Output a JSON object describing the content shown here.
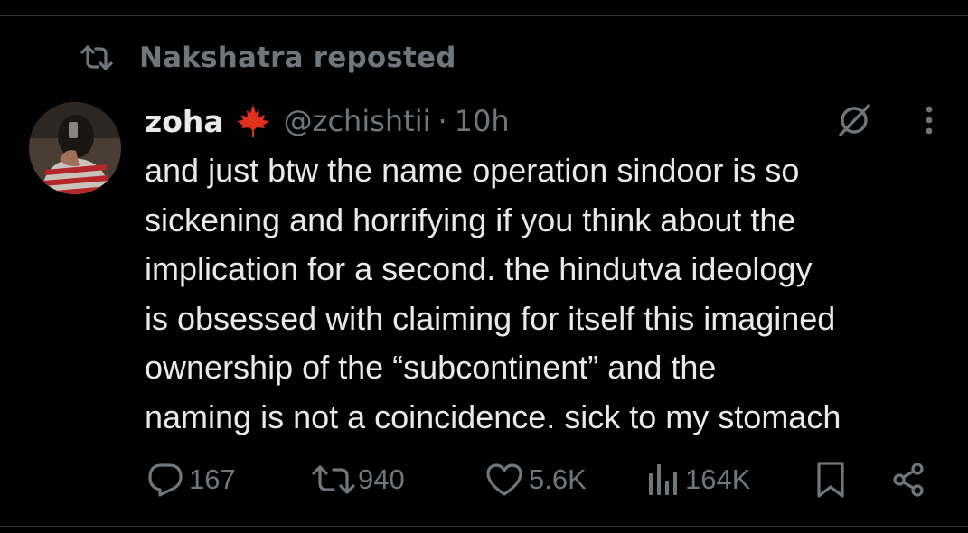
{
  "repost": {
    "label": "Nakshatra reposted",
    "icon": "repost-icon"
  },
  "author": {
    "display_name": "zoha",
    "emoji": "maple-leaf-icon",
    "handle": "@zchishtii",
    "separator": "·",
    "time": "10h"
  },
  "tweet": {
    "lines": [
      "and just btw the name operation sindoor is so",
      "sickening and horrifying if you think about the",
      "implication for a second. the hindutva ideology",
      "is obsessed with claiming for itself this imagined",
      "ownership of the “subcontinent” and the",
      "naming is not a coincidence. sick to my stomach"
    ]
  },
  "actions": {
    "replies": "167",
    "reposts": "940",
    "likes": "5.6K",
    "views": "164K"
  },
  "colors": {
    "background": "#000000",
    "text_primary": "#e7e9ea",
    "text_secondary": "#71767b",
    "divider": "#2f3336",
    "leaf": "#e0301e"
  }
}
